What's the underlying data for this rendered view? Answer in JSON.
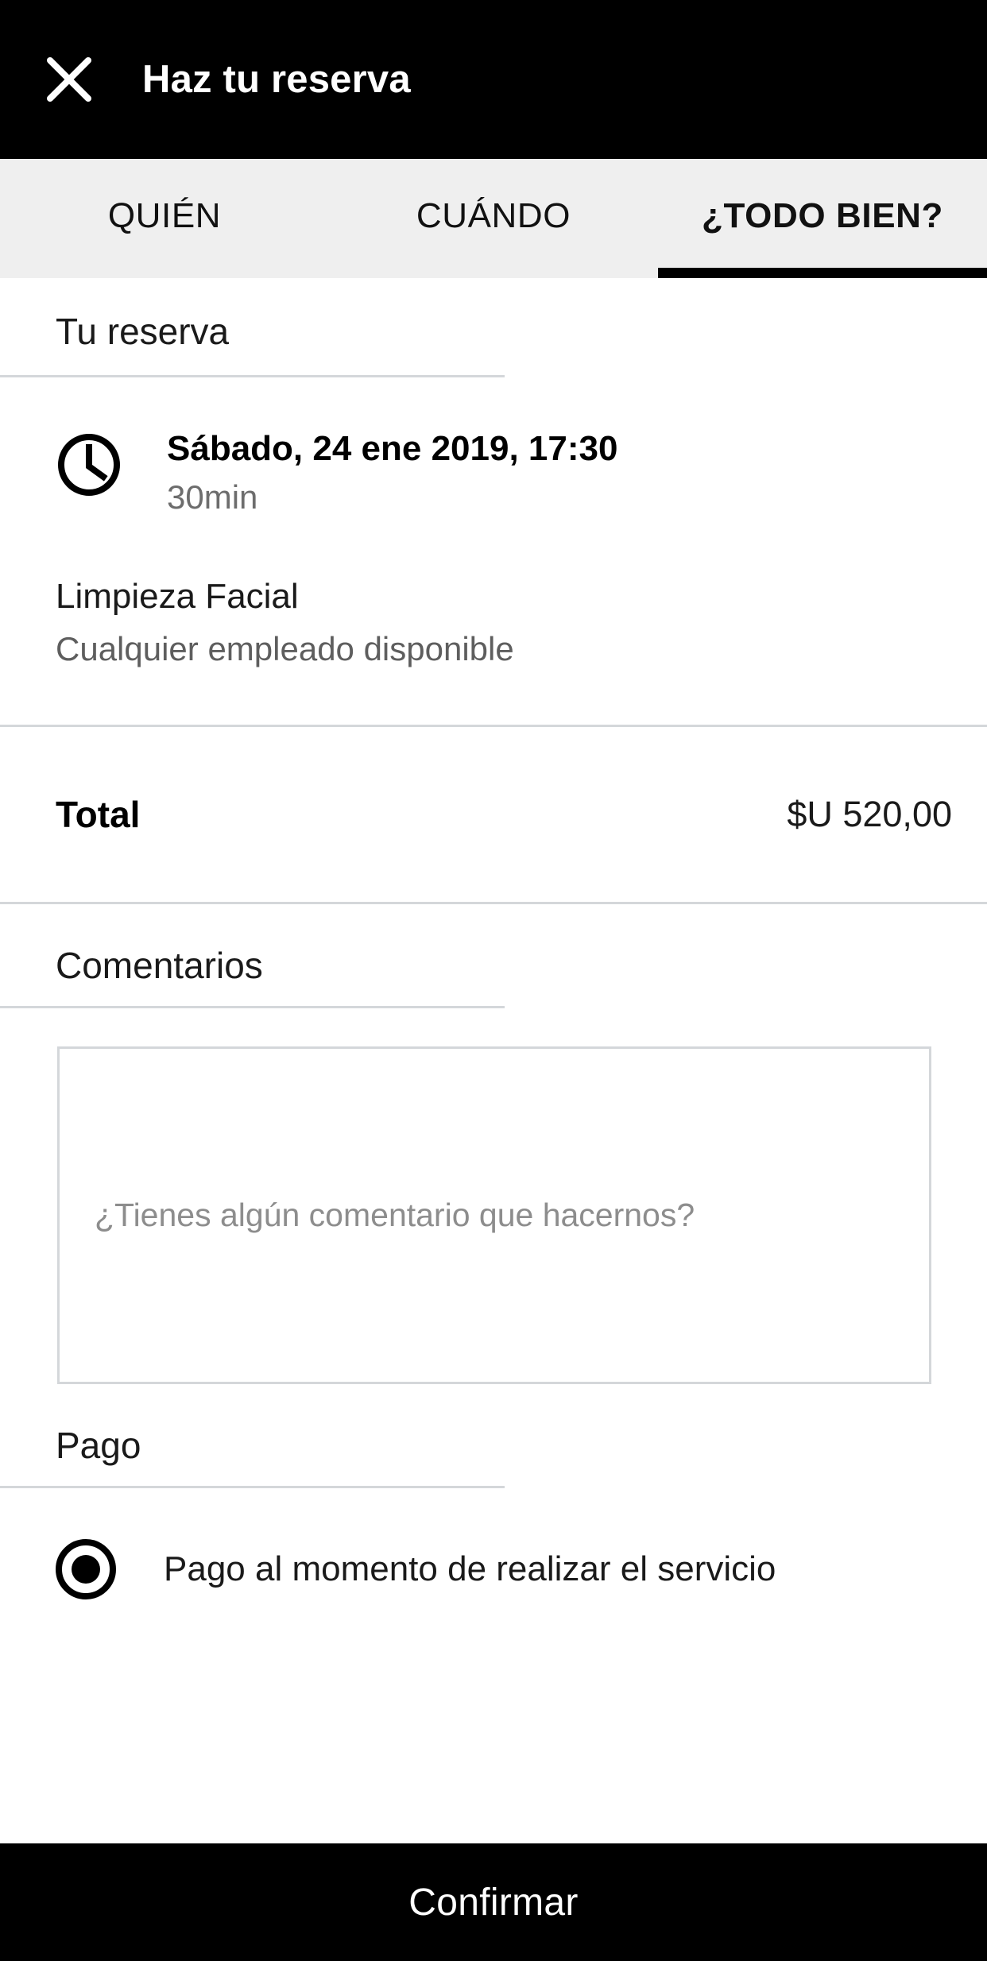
{
  "header": {
    "title": "Haz tu reserva",
    "close_icon": "close-icon"
  },
  "tabs": [
    {
      "label": "QUIÉN",
      "active": false
    },
    {
      "label": "CUÁNDO",
      "active": false
    },
    {
      "label": "¿TODO BIEN?",
      "active": true
    }
  ],
  "reservation": {
    "section_title": "Tu reserva",
    "clock_icon": "clock-icon",
    "datetime": "Sábado, 24 ene 2019, 17:30",
    "duration": "30min",
    "service_name": "Limpieza Facial",
    "service_staff": "Cualquier empleado disponible"
  },
  "total": {
    "label": "Total",
    "value": "$U 520,00"
  },
  "comments": {
    "section_title": "Comentarios",
    "placeholder": "¿Tienes algún comentario que hacernos?",
    "value": ""
  },
  "payment": {
    "section_title": "Pago",
    "options": [
      {
        "label": "Pago al momento de realizar el servicio",
        "selected": true
      }
    ]
  },
  "footer": {
    "confirm_label": "Confirmar"
  },
  "colors": {
    "appbar_bg": "#000000",
    "tabbar_bg": "#efefef",
    "accent": "#000000",
    "divider": "#d4d7da",
    "muted_text": "#6d6d6d",
    "page_bg": "#ffffff"
  }
}
